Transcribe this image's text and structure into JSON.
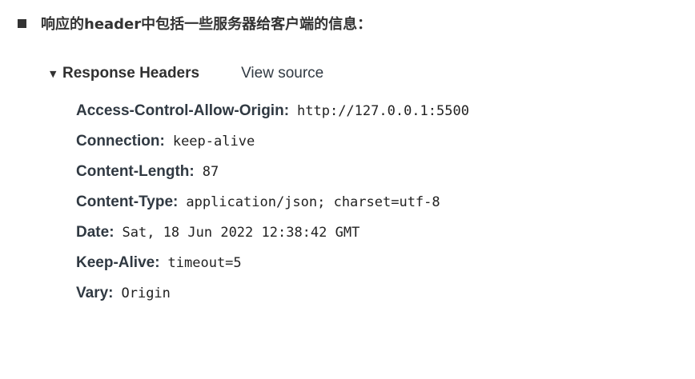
{
  "intro": {
    "text": "响应的header中包括一些服务器给客户端的信息："
  },
  "response_headers": {
    "title": "Response Headers",
    "view_source_label": "View source",
    "expanded_glyph": "▼",
    "separator": ":",
    "items": [
      {
        "name": "Access-Control-Allow-Origin",
        "value": "http://127.0.0.1:5500"
      },
      {
        "name": "Connection",
        "value": "keep-alive"
      },
      {
        "name": "Content-Length",
        "value": "87"
      },
      {
        "name": "Content-Type",
        "value": "application/json; charset=utf-8"
      },
      {
        "name": "Date",
        "value": "Sat, 18 Jun 2022 12:38:42 GMT"
      },
      {
        "name": "Keep-Alive",
        "value": "timeout=5"
      },
      {
        "name": "Vary",
        "value": "Origin"
      }
    ]
  }
}
